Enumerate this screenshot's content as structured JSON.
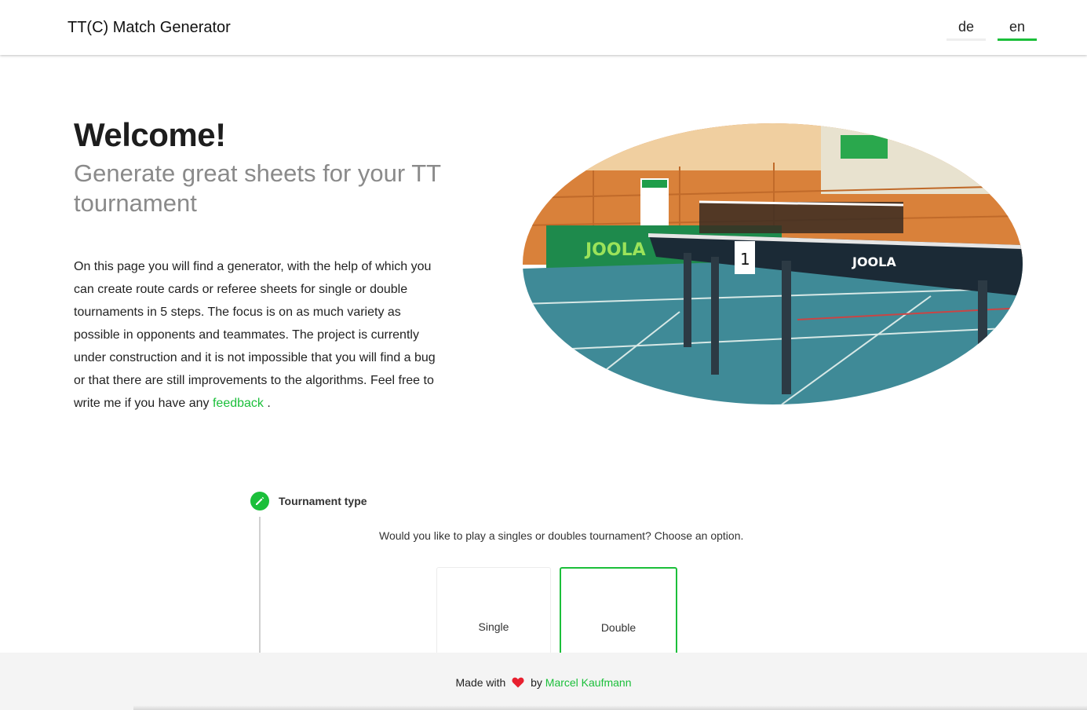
{
  "header": {
    "brand": "TT(C) Match Generator",
    "languages": [
      {
        "code": "de",
        "active": false
      },
      {
        "code": "en",
        "active": true
      }
    ]
  },
  "hero": {
    "title": "Welcome!",
    "subtitle": "Generate great sheets for your TT tournament",
    "intro_text": "On this page you will find a generator, with the help of which you can create route cards or referee sheets for single or double tournaments in 5 steps. The focus is on as much variety as possible in opponents and teammates. The project is currently under construction and it is not impossible that you will find a bug or that there are still improvements to the algorithms. Feel free to write me if you have any",
    "feedback_link": "feedback",
    "intro_end": "."
  },
  "stepper": {
    "step_title": "Tournament type",
    "step_icon": "pencil-icon",
    "description": "Would you like to play a singles or doubles tournament? Choose an option.",
    "options": [
      {
        "label": "Single",
        "selected": false
      },
      {
        "label": "Double",
        "selected": true
      }
    ]
  },
  "footer": {
    "made_with": "Made with",
    "heart_icon": "heart-icon",
    "by": "by",
    "author": "Marcel Kaufmann"
  },
  "colors": {
    "accent": "#1bbf3a",
    "heart": "#e8202f"
  }
}
